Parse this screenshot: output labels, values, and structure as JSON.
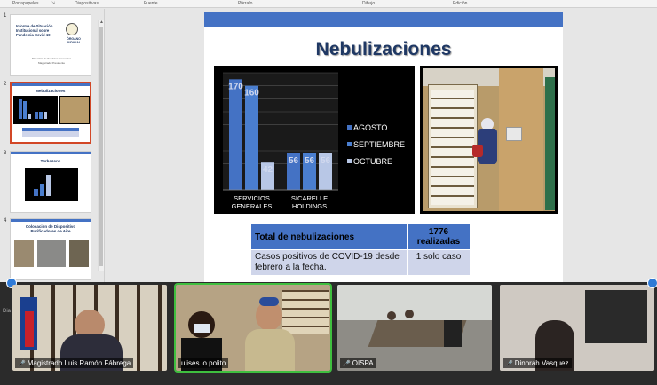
{
  "ribbon": {
    "groups": [
      "Portapapeles",
      "Diapositivas",
      "Fuente",
      "Párrafo",
      "Dibujo",
      "Edición"
    ]
  },
  "thumbnails": [
    {
      "num": "1",
      "title": "Informe de Situación Institucional sobre Pandemia Covid-19",
      "logo": "ÓRGANO JUDICIAL",
      "subtitle": "Dirección de Servicios Generales",
      "sub2": "Magistrado Presidente"
    },
    {
      "num": "2",
      "title": "Nebulizaciones"
    },
    {
      "num": "3",
      "title": "Turbozone"
    },
    {
      "num": "4",
      "title": "Colocación de Dispositivo Purificadores de Aire"
    }
  ],
  "slide": {
    "title": "Nebulizaciones",
    "table": {
      "headers": [
        "Total de nebulizaciones",
        "1776 realizadas"
      ],
      "row": [
        "Casos positivos de COVID-19 desde febrero a la fecha.",
        "1 solo caso"
      ]
    }
  },
  "chart_data": {
    "type": "bar",
    "categories": [
      "SERVICIOS GENERALES",
      "SICARELLE HOLDINGS"
    ],
    "series": [
      {
        "name": "AGOSTO",
        "values": [
          170,
          56
        ],
        "color": "#4472c4"
      },
      {
        "name": "SEPTIEMBRE",
        "values": [
          160,
          56
        ],
        "color": "#4a7ecf"
      },
      {
        "name": "OCTUBRE",
        "values": [
          42,
          56
        ],
        "color": "#b8c7e6"
      }
    ],
    "ylim": [
      0,
      180
    ],
    "grid": true,
    "legend": "right"
  },
  "participants": [
    {
      "name": "Magistrado Luis Ramón Fábrega",
      "muted": true
    },
    {
      "name": "ulises lo polito",
      "muted": false
    },
    {
      "name": "OISPA",
      "muted": true
    },
    {
      "name": "Dinorah Vasquez",
      "muted": true
    }
  ],
  "colors": {
    "accent": "#4472c4",
    "title": "#1f3864",
    "selection": "#d24726",
    "active_speaker": "#3fbf3f"
  }
}
